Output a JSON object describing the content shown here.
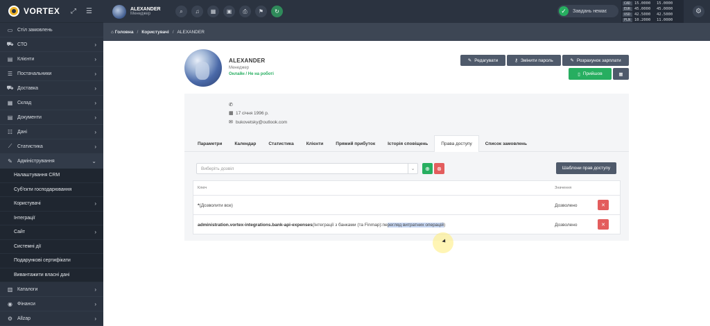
{
  "brand": {
    "name": "VORTEX"
  },
  "sidebar": {
    "items": [
      {
        "label": "Стіл замовлень",
        "icon": "monitor-icon",
        "glyph": "▭",
        "chevron": false
      },
      {
        "label": "СТО",
        "icon": "car-icon",
        "glyph": "⛟",
        "chevron": true
      },
      {
        "label": "Клієнти",
        "icon": "id-card-icon",
        "glyph": "▤",
        "chevron": true
      },
      {
        "label": "Постачальники",
        "icon": "users-icon",
        "glyph": "☰",
        "chevron": true
      },
      {
        "label": "Доставка",
        "icon": "truck-icon",
        "glyph": "⛟",
        "chevron": true
      },
      {
        "label": "Склад",
        "icon": "warehouse-icon",
        "glyph": "▦",
        "chevron": true
      },
      {
        "label": "Документи",
        "icon": "documents-icon",
        "glyph": "▤",
        "chevron": true
      },
      {
        "label": "Дані",
        "icon": "database-icon",
        "glyph": "☷",
        "chevron": true
      },
      {
        "label": "Статистика",
        "icon": "chart-icon",
        "glyph": "⟋",
        "chevron": true
      },
      {
        "label": "Адміністрування",
        "icon": "wrench-icon",
        "glyph": "✎",
        "chevron": "down"
      }
    ],
    "subitems": [
      {
        "label": "Налаштування CRM",
        "chevron": false
      },
      {
        "label": "Суб'єкти господарювання",
        "chevron": false
      },
      {
        "label": "Користувачі",
        "chevron": true
      },
      {
        "label": "Інтеграції",
        "chevron": false
      },
      {
        "label": "Сайт",
        "chevron": true
      },
      {
        "label": "Системні дії",
        "chevron": false
      },
      {
        "label": "Подарункові сертифікати",
        "chevron": false
      },
      {
        "label": "Вивантажити власні дані",
        "chevron": false
      }
    ],
    "bottom_items": [
      {
        "label": "Каталоги",
        "icon": "catalog-icon",
        "glyph": "▥",
        "chevron": true
      },
      {
        "label": "Фінанси",
        "icon": "finance-icon",
        "glyph": "◉",
        "chevron": true
      },
      {
        "label": "Allzap",
        "icon": "allzap-icon",
        "glyph": "⚙",
        "chevron": true
      }
    ]
  },
  "topbar": {
    "user_name": "ALEXANDER",
    "user_role": "Менеджер",
    "task_status": "Завдань немає",
    "rates": [
      {
        "cur": "CAD",
        "a": "15.0000",
        "b": "15.0000"
      },
      {
        "cur": "EUR",
        "a": "45.0000",
        "b": "45.0000"
      },
      {
        "cur": "USD",
        "a": "42.5000",
        "b": "42.5000"
      },
      {
        "cur": "PLN",
        "a": "10.2000",
        "b": "11.0000"
      }
    ]
  },
  "breadcrumb": {
    "home": "Головна",
    "section": "Користувачі",
    "current": "ALEXANDER"
  },
  "profile": {
    "name": "ALEXANDER",
    "role": "Менеджер",
    "status": "Онлайн / Не на роботі",
    "birthday": "17 січня 1996 р.",
    "email": "bukovetsky@outlook.com"
  },
  "actions": {
    "edit": "Редагувати",
    "change_password": "Змінити пароль",
    "salary": "Розрахунок зарплати",
    "checkin": "Прийшов"
  },
  "tabs": [
    "Параметри",
    "Календар",
    "Статистика",
    "Клієнти",
    "Прямий прибуток",
    "Історія сповіщень",
    "Права доступу",
    "Список замовлень"
  ],
  "access": {
    "select_placeholder": "Виберіть дозвіл",
    "templates_button": "Шаблони прав доступу",
    "col_key": "Ключ",
    "col_value": "Значення",
    "rows": [
      {
        "key": "*",
        "desc": " (Дозволити все)",
        "value": "Дозволено"
      },
      {
        "key": "administration.vortex-integrations.bank-api-expenses",
        "desc": " (Інтеграції з банками (та Finmap): ",
        "desc_hl_plain": "пе",
        "desc_hl": "регляд витратних операцій",
        "desc_end": ")",
        "value": "Дозволено"
      }
    ]
  }
}
